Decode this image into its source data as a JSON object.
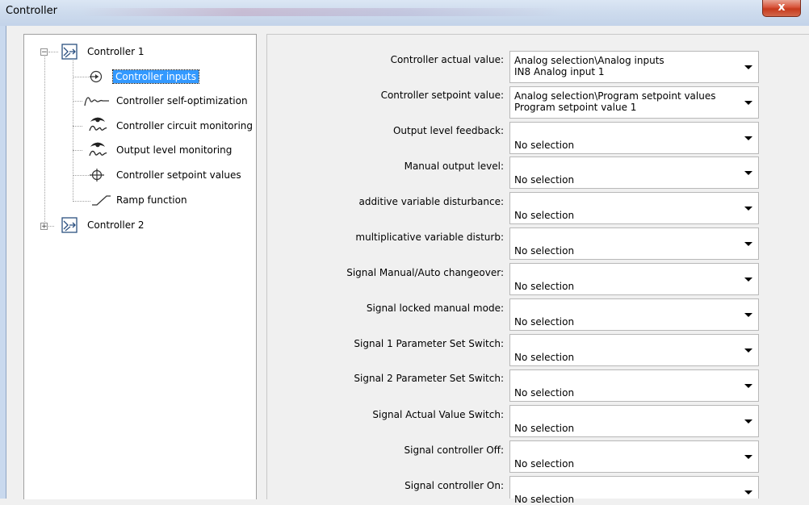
{
  "window": {
    "title": "Controller",
    "close_label": "x"
  },
  "tree": {
    "nodes": [
      {
        "label": "Controller 1",
        "expander": "−"
      },
      {
        "label": "Controller inputs"
      },
      {
        "label": "Controller self-optimization"
      },
      {
        "label": "Controller circuit monitoring"
      },
      {
        "label": "Output level monitoring"
      },
      {
        "label": "Controller setpoint values"
      },
      {
        "label": "Ramp function"
      },
      {
        "label": "Controller 2",
        "expander": "+"
      }
    ]
  },
  "form": {
    "fields": [
      {
        "label": "Controller actual value:",
        "line1": "Analog selection\\Analog inputs",
        "line2": "IN8 Analog input 1"
      },
      {
        "label": "Controller setpoint value:",
        "line1": "Analog selection\\Program setpoint values",
        "line2": "Program setpoint value 1"
      },
      {
        "label": "Output level feedback:",
        "line1": "No selection",
        "line2": ""
      },
      {
        "label": "Manual output level:",
        "line1": "No selection",
        "line2": ""
      },
      {
        "label": "additive variable disturbance:",
        "line1": "No selection",
        "line2": ""
      },
      {
        "label": "multiplicative variable disturb:",
        "line1": "No selection",
        "line2": ""
      },
      {
        "label": "Signal  Manual/Auto changeover:",
        "line1": "No selection",
        "line2": ""
      },
      {
        "label": "Signal locked manual mode:",
        "line1": "No selection",
        "line2": ""
      },
      {
        "label": "Signal 1 Parameter Set Switch:",
        "line1": "No selection",
        "line2": ""
      },
      {
        "label": "Signal 2 Parameter Set Switch:",
        "line1": "No selection",
        "line2": ""
      },
      {
        "label": "Signal Actual Value Switch:",
        "line1": "No selection",
        "line2": ""
      },
      {
        "label": "Signal controller Off:",
        "line1": "No selection",
        "line2": ""
      },
      {
        "label": "Signal controller On:",
        "line1": "No selection",
        "line2": ""
      }
    ]
  }
}
